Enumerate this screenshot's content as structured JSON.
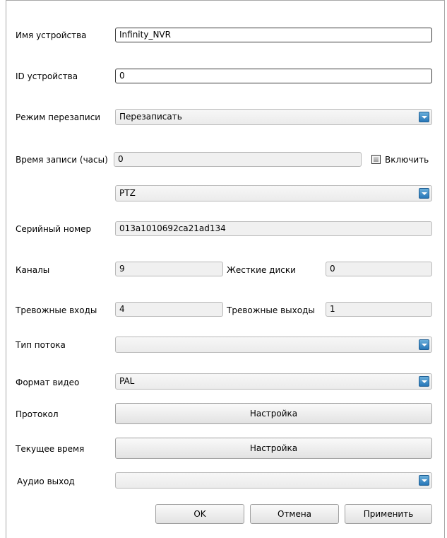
{
  "form": {
    "device_name": {
      "label": "Имя устройства",
      "value": "Infinity_NVR"
    },
    "device_id": {
      "label": "ID устройства",
      "value": "0"
    },
    "overwrite_mode": {
      "label": "Режим перезаписи",
      "value": "Перезаписать"
    },
    "record_time": {
      "label": "Время записи (часы)",
      "value": "0",
      "enable_label": "Включить",
      "enable_checked": false
    },
    "ptz": {
      "value": "PTZ"
    },
    "serial_number": {
      "label": "Серийный номер",
      "value": "013a1010692ca21ad134"
    },
    "channels": {
      "label": "Каналы",
      "value": "9"
    },
    "hard_disks": {
      "label": "Жесткие диски",
      "value": "0"
    },
    "alarm_inputs": {
      "label": "Тревожные входы",
      "value": "4"
    },
    "alarm_outputs": {
      "label": "Тревожные выходы",
      "value": "1"
    },
    "stream_type": {
      "label": "Тип потока",
      "value": ""
    },
    "video_format": {
      "label": "Формат видео",
      "value": "PAL"
    },
    "protocol": {
      "label": "Протокол",
      "button": "Настройка"
    },
    "current_time": {
      "label": "Текущее время",
      "button": "Настройка"
    },
    "audio_out": {
      "label": "Аудио выход",
      "value": ""
    }
  },
  "footer": {
    "ok": "OK",
    "cancel": "Отмена",
    "apply": "Применить"
  },
  "icons": {
    "dropdown": "chevron-down-icon",
    "checkbox": "checkbox-unchecked"
  },
  "colors": {
    "dropdown_accent": "#2877b8",
    "edit_border": "#3a3a3a"
  }
}
